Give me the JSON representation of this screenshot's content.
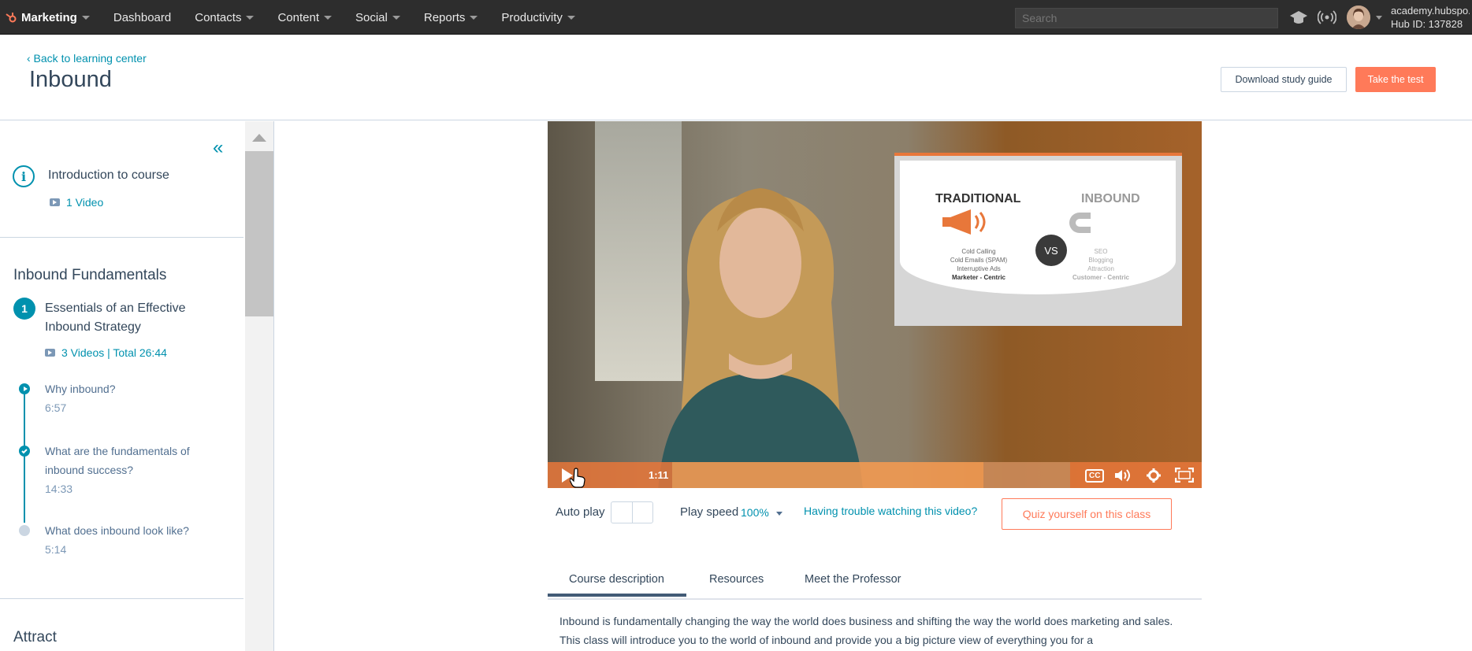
{
  "nav": {
    "brand": "Marketing",
    "items": [
      "Dashboard",
      "Contacts",
      "Content",
      "Social",
      "Reports",
      "Productivity"
    ],
    "search_placeholder": "Search",
    "account_domain": "academy.hubspo...",
    "hub_id": "Hub ID: 137828"
  },
  "header": {
    "back_link": "‹ Back to learning center",
    "title": "Inbound",
    "download_button": "Download study guide",
    "test_button": "Take the test"
  },
  "sidebar": {
    "intro": {
      "title": "Introduction to course",
      "meta": "1 Video"
    },
    "section1": {
      "title": "Inbound Fundamentals",
      "lesson_number": "1",
      "lesson_title": "Essentials of an Effective Inbound Strategy",
      "lesson_meta": "3 Videos | Total 26:44",
      "videos": [
        {
          "title": "Why inbound?",
          "duration": "6:57",
          "state": "playing"
        },
        {
          "title": "What are the fundamentals of inbound success?",
          "duration": "14:33",
          "state": "done"
        },
        {
          "title": "What does inbound look like?",
          "duration": "5:14",
          "state": "pending"
        }
      ]
    },
    "section2": {
      "title": "Attract"
    }
  },
  "video": {
    "time": "1:11",
    "progress_fraction": 0.6,
    "slide": {
      "left_heading": "TRADITIONAL",
      "right_heading": "INBOUND",
      "vs": "VS",
      "left_items": [
        "Cold Calling",
        "Cold Emails (SPAM)",
        "Interruptive Ads",
        "Marketer - Centric"
      ],
      "right_items": [
        "SEO",
        "Blogging",
        "Attraction",
        "Customer - Centric"
      ]
    }
  },
  "player_bar": {
    "autoplay_label": "Auto play",
    "speed_label": "Play speed",
    "speed_value": "100%",
    "trouble_link": "Having trouble watching this video?",
    "quiz_button": "Quiz yourself on this class"
  },
  "tabs": [
    "Course description",
    "Resources",
    "Meet the Professor"
  ],
  "description": "Inbound is fundamentally changing the way the world does business and shifting the way the world does marketing and sales. This class will introduce you to the world of inbound and provide you a big picture view of everything you for a",
  "colors": {
    "accent": "#0091ae",
    "brand_orange": "#ff7a59",
    "nav_bg": "#2d2d2d"
  }
}
